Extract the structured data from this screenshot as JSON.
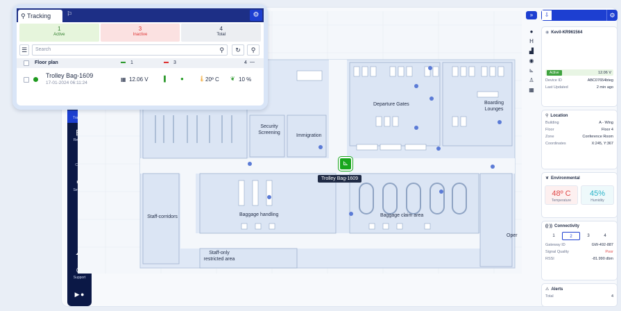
{
  "tracking_panel": {
    "tab_label": "Tracking",
    "stats": [
      {
        "value": "1",
        "label": "Active"
      },
      {
        "value": "3",
        "label": "Inactive"
      },
      {
        "value": "4",
        "label": "Total"
      }
    ],
    "search_placeholder": "Search",
    "group": {
      "label": "Floor plan",
      "green_count": "1",
      "red_count": "3",
      "total": "4"
    },
    "item": {
      "name": "Trolley Bag-1609",
      "datetime": "17-01-2024 06:11:24",
      "voltage": "12.06 V",
      "temperature": "20º C",
      "humidity": "10 %"
    }
  },
  "nav": {
    "tracking": "Tracking",
    "reports": "Reports",
    "chart": "Chart",
    "settings": "Settings",
    "support": "Support"
  },
  "map": {
    "labels": {
      "departure_gates": "Departure Gates",
      "boarding_lounges": "Boarding Lounges",
      "security_screening": "Security Screening",
      "immigration": "Immigration",
      "staff_corridors": "Staff-corridors",
      "baggage_handling": "Baggage handling",
      "baggage_claim": "Baggage claim area",
      "staff_only": "Staff-only restricted area",
      "oper_cut": "Oper"
    },
    "tooltip": "Trolley Bag-1609"
  },
  "right_panel": {
    "device_title": "Kevil-KR961564",
    "status": "Active",
    "voltage": "12.06 V",
    "device_id_label": "Device ID",
    "device_id": "ABC07654bteg",
    "last_updated_label": "Last Updated",
    "last_updated": "2 min ago",
    "location": {
      "title": "Location",
      "rows": [
        {
          "k": "Building",
          "v": "A - Wing"
        },
        {
          "k": "Floor",
          "v": "Floor 4"
        },
        {
          "k": "Zone",
          "v": "Conference Room"
        },
        {
          "k": "Coordinates",
          "v": "X:245, Y:367"
        }
      ]
    },
    "environmental": {
      "title": "Environmental",
      "temp": "48º C",
      "temp_label": "Temperature",
      "hum": "45%",
      "hum_label": "Humidity"
    },
    "connectivity": {
      "title": "Connectivity",
      "tabs": [
        "1",
        "2",
        "3",
        "4"
      ],
      "rows": [
        {
          "k": "Gateway ID",
          "v": "GW-492-887"
        },
        {
          "k": "Signal Quality",
          "v": "Poor"
        },
        {
          "k": "RSSI",
          "v": "-81.990 dbm"
        }
      ]
    },
    "alerts": {
      "title": "Alerts",
      "total_label": "Total",
      "total": "4"
    }
  }
}
